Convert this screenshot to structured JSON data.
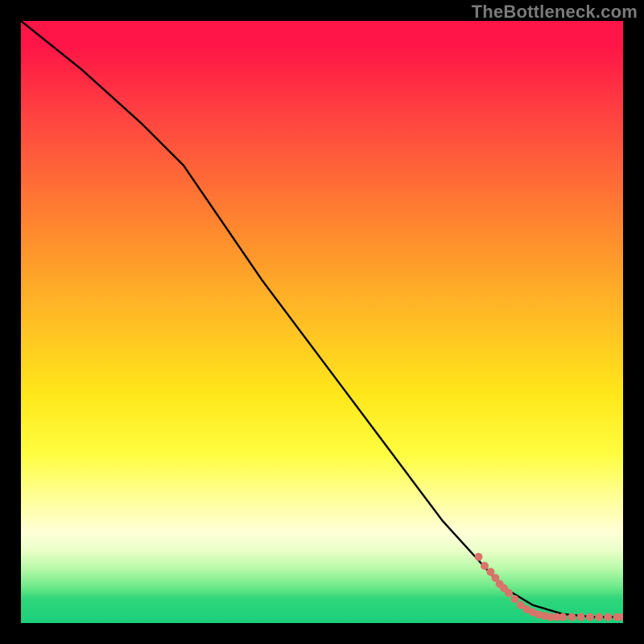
{
  "watermark": "TheBottleneck.com",
  "chart_data": {
    "type": "line",
    "title": "",
    "xlabel": "",
    "ylabel": "",
    "xlim": [
      0,
      100
    ],
    "ylim": [
      0,
      100
    ],
    "curve": {
      "name": "bottleneck-curve",
      "x": [
        0,
        10,
        20,
        27,
        40,
        55,
        70,
        80,
        85,
        90,
        95,
        100
      ],
      "y": [
        100,
        92,
        83,
        76,
        57,
        37,
        17,
        6,
        3,
        1.5,
        1,
        1
      ]
    },
    "scatter": {
      "name": "data-points",
      "color": "#d9746a",
      "points": [
        {
          "x": 76,
          "y": 11
        },
        {
          "x": 77,
          "y": 9.5
        },
        {
          "x": 78,
          "y": 8.5
        },
        {
          "x": 78.8,
          "y": 7.5
        },
        {
          "x": 79.5,
          "y": 6.5
        },
        {
          "x": 80.2,
          "y": 5.8
        },
        {
          "x": 81,
          "y": 5
        },
        {
          "x": 82,
          "y": 4
        },
        {
          "x": 83,
          "y": 3
        },
        {
          "x": 84,
          "y": 2.3
        },
        {
          "x": 85,
          "y": 1.8
        },
        {
          "x": 86,
          "y": 1.4
        },
        {
          "x": 87,
          "y": 1.2
        },
        {
          "x": 88,
          "y": 1
        },
        {
          "x": 89,
          "y": 1
        },
        {
          "x": 90,
          "y": 1
        },
        {
          "x": 91.5,
          "y": 1
        },
        {
          "x": 93,
          "y": 1
        },
        {
          "x": 94.5,
          "y": 1
        },
        {
          "x": 96,
          "y": 1
        },
        {
          "x": 97.5,
          "y": 1
        },
        {
          "x": 99,
          "y": 1
        },
        {
          "x": 100,
          "y": 1
        }
      ]
    },
    "gradient_stops": [
      {
        "y": 100,
        "color": "#ff1547"
      },
      {
        "y": 60,
        "color": "#ff8a2e"
      },
      {
        "y": 30,
        "color": "#ffe71b"
      },
      {
        "y": 12,
        "color": "#ffffd8"
      },
      {
        "y": 0,
        "color": "#1bcf7c"
      }
    ]
  }
}
